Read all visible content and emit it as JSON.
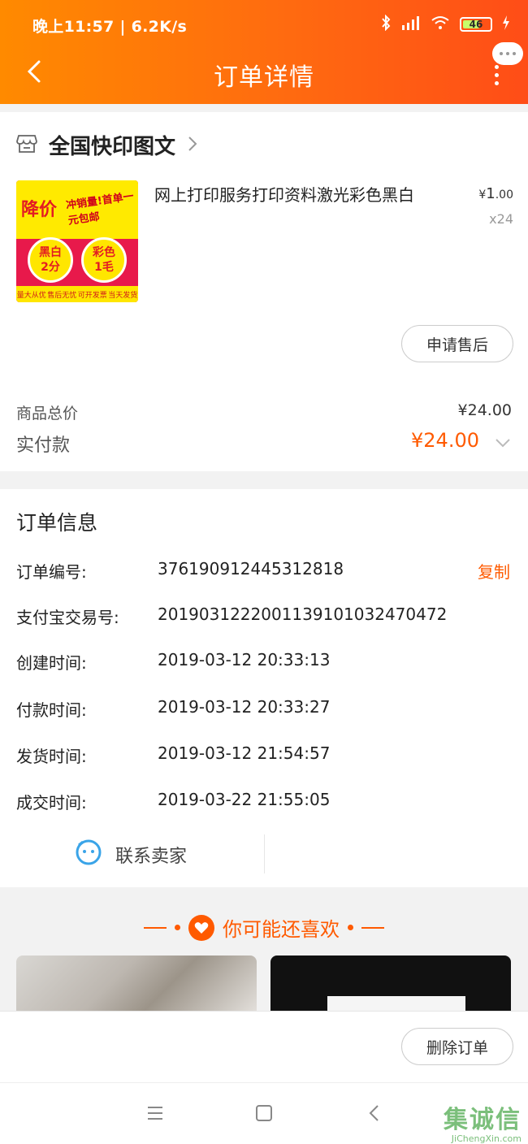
{
  "status_bar": {
    "time": "晚上11:57 | 6.2K/s",
    "battery": "46"
  },
  "nav": {
    "title": "订单详情"
  },
  "shop": {
    "name": "全国快印图文",
    "product": {
      "title": "网上打印服务打印资料激光彩色黑白",
      "price_symbol": "¥",
      "price_int": "1",
      "price_dec": ".00",
      "qty": "x24",
      "image_texts": {
        "headline": "降价",
        "promo": "冲销量!首单一元包邮",
        "bw": "黑白",
        "bw_price": "2分",
        "color": "彩色",
        "color_price": "1毛",
        "footer": [
          "量大从优",
          "售后无忧",
          "可开发票",
          "当天发货"
        ]
      }
    },
    "aftersale_label": "申请售后",
    "total_label": "商品总价",
    "total_value": "¥24.00",
    "paid_label": "实付款",
    "paid_value": "¥24.00"
  },
  "order_info": {
    "heading": "订单信息",
    "rows": [
      {
        "label": "订单编号:",
        "value": "376190912445312818"
      },
      {
        "label": "支付宝交易号:",
        "value": "2019031222001139101032470472"
      },
      {
        "label": "创建时间:",
        "value": "2019-03-12 20:33:13"
      },
      {
        "label": "付款时间:",
        "value": "2019-03-12 20:33:27"
      },
      {
        "label": "发货时间:",
        "value": "2019-03-12 21:54:57"
      },
      {
        "label": "成交时间:",
        "value": "2019-03-22 21:55:05"
      }
    ],
    "copy_label": "复制",
    "contact_label": "联系卖家"
  },
  "recommend": {
    "title": "你可能还喜欢"
  },
  "bottom": {
    "delete_label": "删除订单"
  },
  "watermark": {
    "main": "集诚信",
    "sub": "JiChengXin.com"
  },
  "colors": {
    "accent": "#ff5a00",
    "header_start": "#ff8a00",
    "header_end": "#ff4d17"
  }
}
